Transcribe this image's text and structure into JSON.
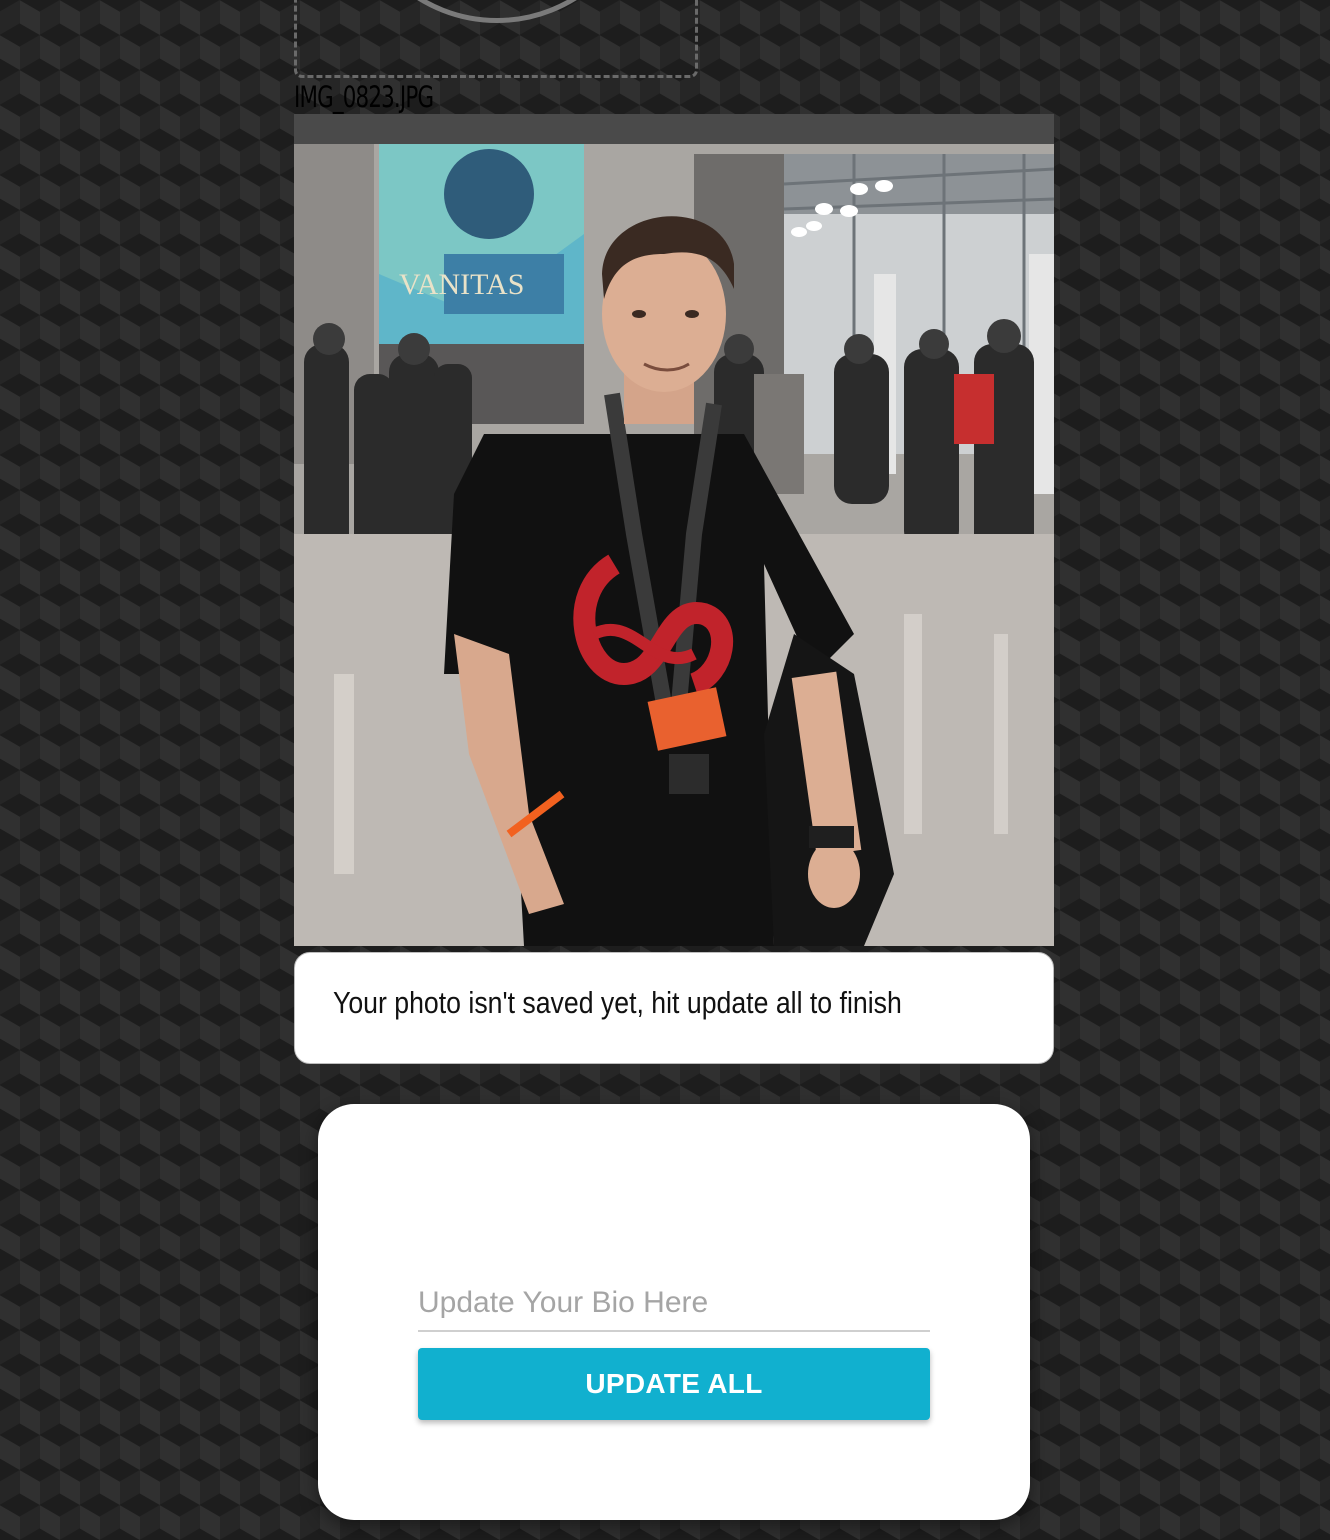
{
  "upload": {
    "filename": "IMG_0823.JPG"
  },
  "preview": {
    "alt": "Uploaded profile photo preview"
  },
  "notice": {
    "message": "Your photo isn't saved yet, hit update all to finish"
  },
  "form": {
    "bio_placeholder": "Update Your Bio Here",
    "bio_value": "",
    "update_button_label": "UPDATE ALL"
  },
  "colors": {
    "accent": "#11b0cf",
    "background": "#262626",
    "card": "#ffffff"
  }
}
